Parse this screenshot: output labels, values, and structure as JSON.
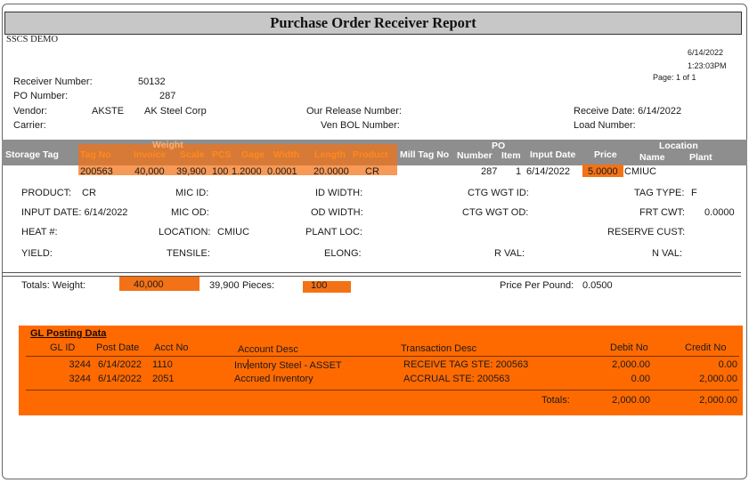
{
  "report": {
    "title": "Purchase Order Receiver Report",
    "company": "SSCS DEMO",
    "date": "6/14/2022",
    "time": "1:23:03PM",
    "page": "Page: 1 of 1"
  },
  "header": {
    "receiver_label": "Receiver Number:",
    "receiver_value": "50132",
    "po_label": "PO Number:",
    "po_value": "287",
    "vendor_label": "Vendor:",
    "vendor_code": "AKSTE",
    "vendor_name": "AK Steel Corp",
    "carrier_label": "Carrier:",
    "release_label": "Our Release Number:",
    "bol_label": "Ven BOL Number:",
    "receive_date_label": "Receive Date: 6/14/2022",
    "load_label": "Load Number:"
  },
  "columns": {
    "storage_tag": "Storage Tag",
    "tag_no": "Tag No",
    "weight_group": "Weight",
    "invoice": "Invoice",
    "scale": "Scale",
    "pcs": "PCS",
    "gage": "Gage",
    "width": "Width",
    "length": "Length",
    "product": "Product",
    "mill_tag": "Mill Tag No",
    "po_group": "PO",
    "number": "Number",
    "item": "Item",
    "input_date": "Input Date",
    "price": "Price",
    "location_group": "Location",
    "name": "Name",
    "plant": "Plant"
  },
  "row": {
    "tag_no": "200563",
    "invoice": "40,000",
    "scale": "39,900",
    "pcs": "100",
    "gage": "1.2000",
    "width": "0.0001",
    "length": "20.0000",
    "product": "CR",
    "po_number": "287",
    "item": "1",
    "input_date": "6/14/2022",
    "price": "5.0000",
    "location": "CMIUC"
  },
  "details": {
    "product_label": "PRODUCT:",
    "product_value": "CR",
    "mic_id_label": "MIC ID:",
    "id_width_label": "ID WIDTH:",
    "ctg_wgt_id_label": "CTG WGT ID:",
    "tag_type_label": "TAG TYPE:",
    "tag_type_value": "F",
    "input_date_label": "INPUT DATE: 6/14/2022",
    "mic_od_label": "MIC OD:",
    "od_width_label": "OD WIDTH:",
    "ctg_wgt_od_label": "CTG WGT OD:",
    "frt_cwt_label": "FRT CWT:",
    "frt_cwt_value": "0.0000",
    "heat_label": "HEAT #:",
    "location_label": "LOCATION:",
    "location_value": "CMIUC",
    "plant_loc_label": "PLANT LOC:",
    "reserve_label": "RESERVE CUST:",
    "yield_label": "YIELD:",
    "tensile_label": "TENSILE:",
    "elong_label": "ELONG:",
    "rval_label": "R VAL:",
    "nval_label": "N VAL:"
  },
  "totals": {
    "label": "Totals:  Weight:",
    "weight": "40,000",
    "scale": "39,900",
    "pieces_label": "Pieces:",
    "pieces": "100",
    "ppp_label": "Price Per Pound:",
    "ppp_value": "0.0500"
  },
  "gl": {
    "title": "GL Posting Data",
    "headers": {
      "gl_id": "GL ID",
      "post_date": "Post Date",
      "acct_no": "Acct No",
      "account_desc": "Account Desc",
      "transaction_desc": "Transaction Desc",
      "debit": "Debit No",
      "credit": "Credit No"
    },
    "rows": [
      {
        "gl_id": "3244",
        "post_date": "6/14/2022",
        "acct_no": "1110",
        "account_desc_a": "Inv",
        "account_desc_b": "entory Steel - ASSET",
        "transaction_desc": "RECEIVE TAG STE: 200563",
        "debit": "2,000.00",
        "credit": "0.00"
      },
      {
        "gl_id": "3244",
        "post_date": "6/14/2022",
        "acct_no": "2051",
        "account_desc_a": "Accrued Inventory",
        "account_desc_b": "",
        "transaction_desc": "ACCRUAL STE: 200563",
        "debit": "0.00",
        "credit": "2,000.00"
      }
    ],
    "totals_label": "Totals:",
    "total_debit": "2,000.00",
    "total_credit": "2,000.00"
  },
  "colors": {
    "highlight": "#f47216",
    "gl_band": "#ff6a00",
    "header_band": "#8e8e8e",
    "header_orange_text": "#ff8a1a"
  }
}
